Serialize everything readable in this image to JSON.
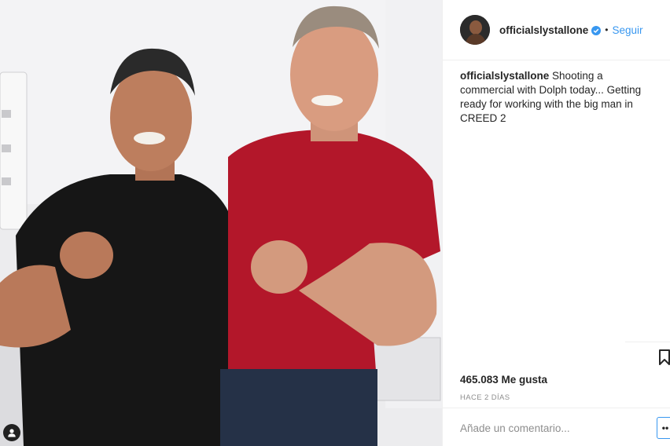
{
  "post": {
    "username": "officialslystallone",
    "follow_label": "Seguir",
    "separator": "•",
    "caption_user": "officialslystallone",
    "caption_text": " Shooting a commercial with Dolph today... Getting ready for working with the big man in CREED 2",
    "likes": "465.083 Me gusta",
    "time_ago": "HACE 2 DÍAS"
  },
  "comment": {
    "placeholder": "Añade un comentario...",
    "more_label": "••"
  },
  "icons": {
    "verified": "verified-badge-icon",
    "save": "bookmark-icon",
    "tag": "tagged-people-icon"
  },
  "colors": {
    "accent": "#3897f0",
    "text": "#262626",
    "muted": "#8e8e8e",
    "border": "#efefef"
  }
}
